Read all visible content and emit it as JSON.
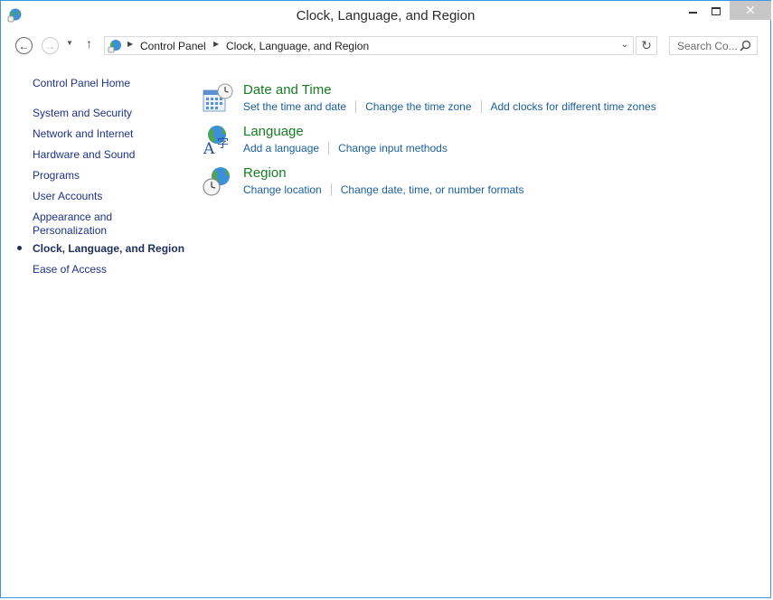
{
  "window": {
    "title": "Clock, Language, and Region",
    "close_glyph": "✕"
  },
  "navigation": {
    "back_glyph": "←",
    "forward_glyph": "→",
    "up_glyph": "↑",
    "recent_glyph": "▼"
  },
  "address_bar": {
    "breadcrumbs": [
      "Control Panel",
      "Clock, Language, and Region"
    ],
    "separator_glyph": "▶",
    "dropdown_glyph": "⌄",
    "refresh_glyph": "↻"
  },
  "search": {
    "placeholder": "Search Co..."
  },
  "sidebar": {
    "home": "Control Panel Home",
    "items": [
      {
        "label": "System and Security"
      },
      {
        "label": "Network and Internet"
      },
      {
        "label": "Hardware and Sound"
      },
      {
        "label": "Programs"
      },
      {
        "label": "User Accounts"
      },
      {
        "label": "Appearance and",
        "label2": "Personalization"
      },
      {
        "label": "Clock, Language, and Region",
        "current": true
      },
      {
        "label": "Ease of Access"
      }
    ]
  },
  "categories": [
    {
      "title": "Date and Time",
      "icon": "calendar-clock-icon",
      "links": [
        "Set the time and date",
        "Change the time zone",
        "Add clocks for different time zones"
      ]
    },
    {
      "title": "Language",
      "icon": "language-globe-icon",
      "links": [
        "Add a language",
        "Change input methods"
      ]
    },
    {
      "title": "Region",
      "icon": "region-globe-clock-icon",
      "links": [
        "Change location",
        "Change date, time, or number formats"
      ]
    }
  ],
  "colors": {
    "category_title": "#167d22",
    "link": "#1a5fa0",
    "sidebar_link": "#1e3287",
    "window_border": "#3e97e0"
  }
}
